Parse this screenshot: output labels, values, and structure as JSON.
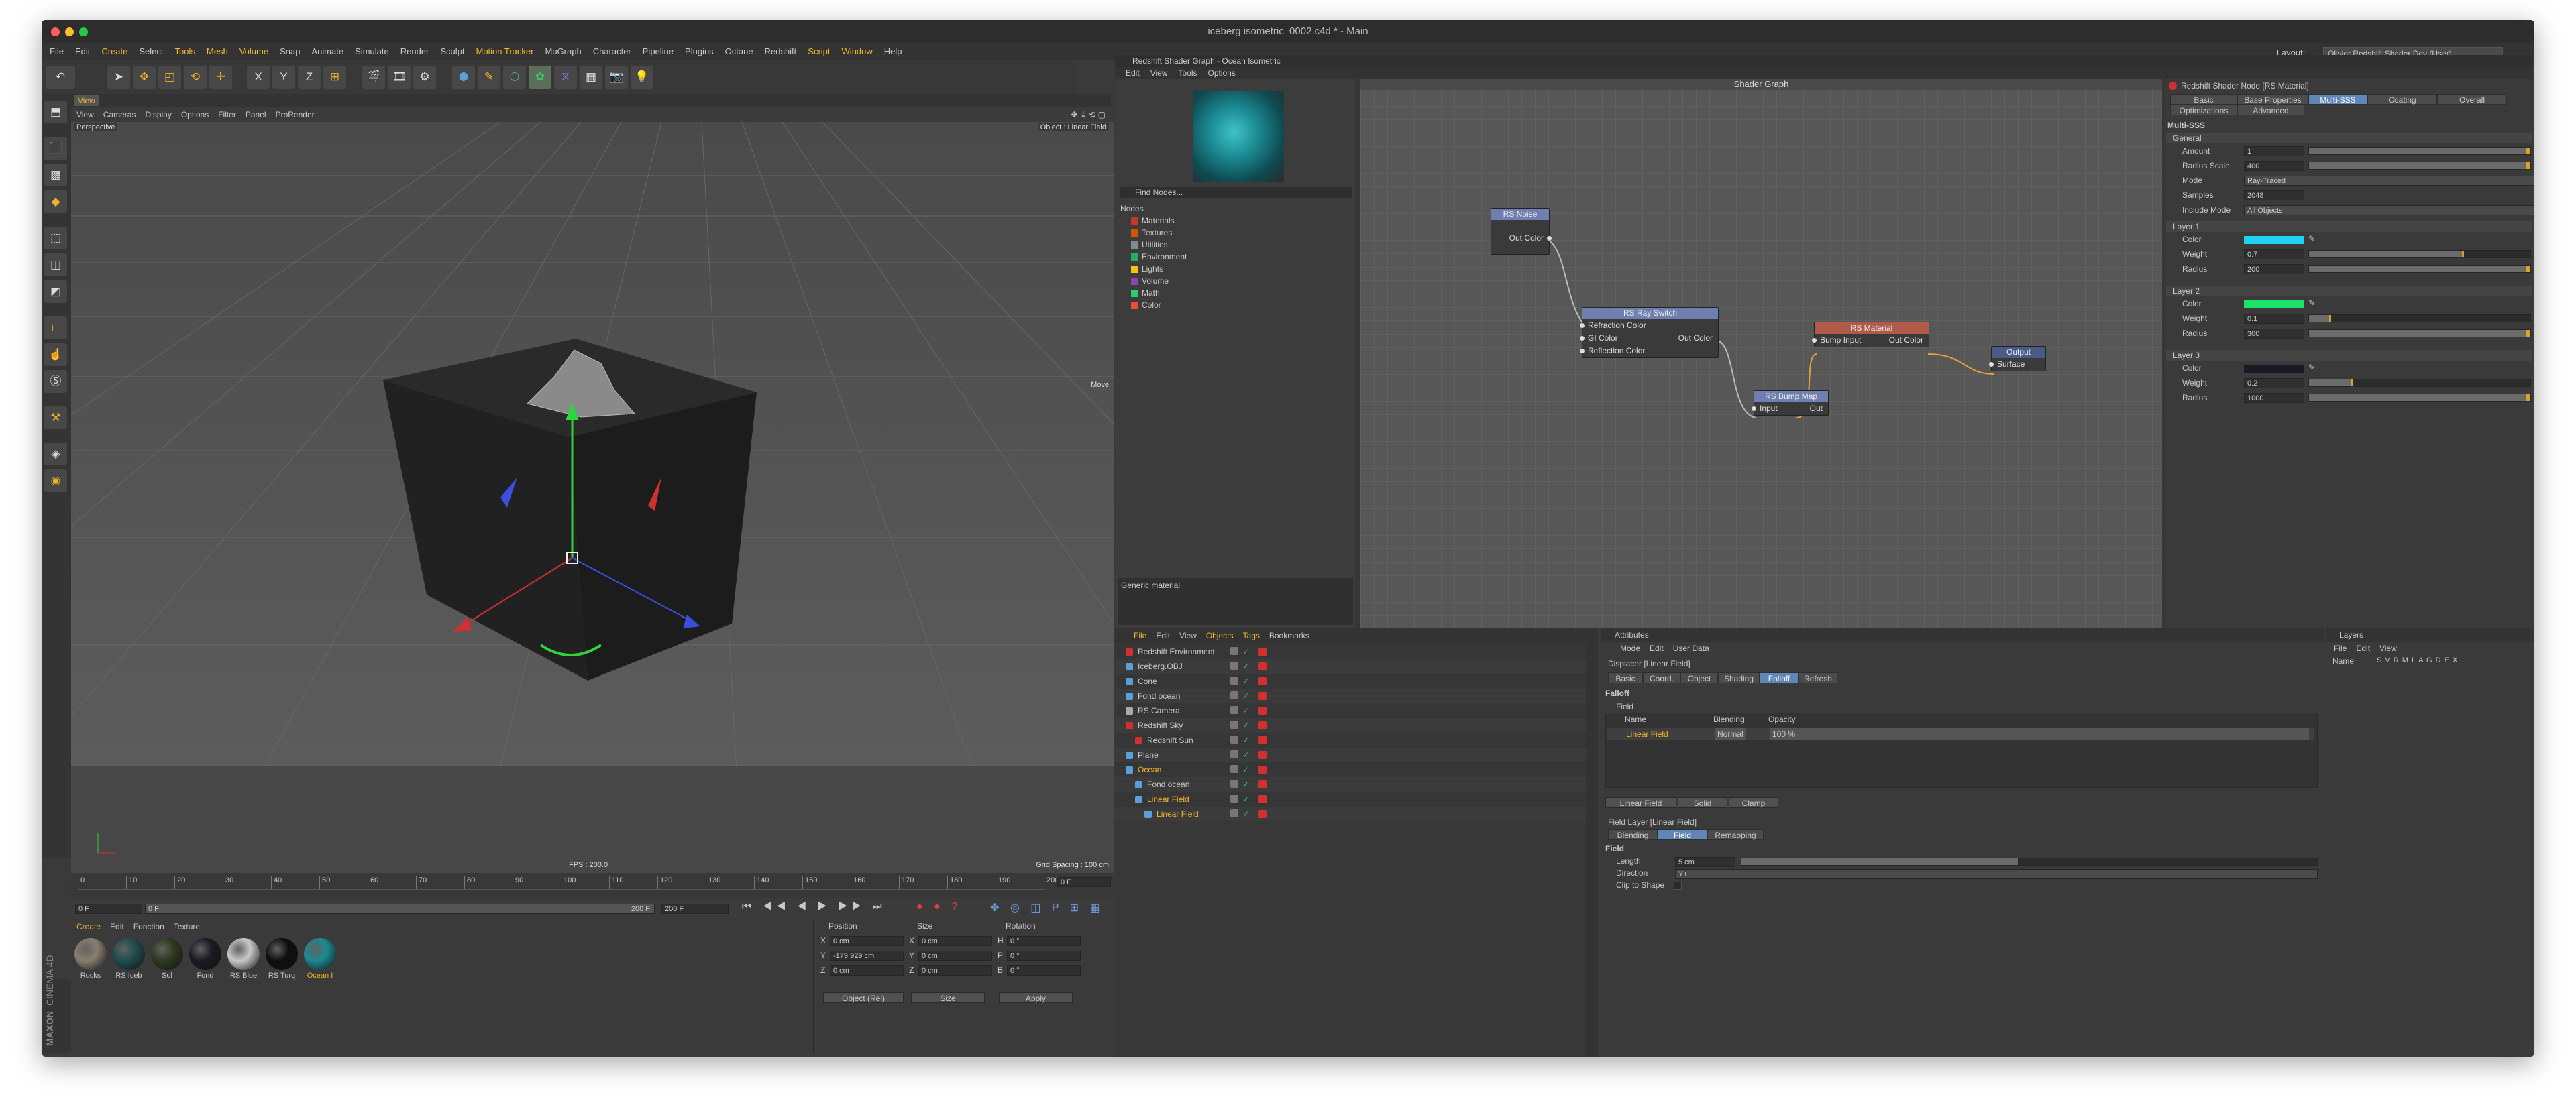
{
  "window": {
    "title": "iceberg isometric_0002.c4d * - Main"
  },
  "menu": [
    "File",
    "Edit",
    "Create",
    "Select",
    "Tools",
    "Mesh",
    "Volume",
    "Snap",
    "Animate",
    "Simulate",
    "Render",
    "Sculpt",
    "Motion Tracker",
    "MoGraph",
    "Character",
    "Pipeline",
    "Plugins",
    "Octane",
    "Redshift",
    "Script",
    "Window",
    "Help"
  ],
  "menu_highlight": [
    "Create",
    "Tools",
    "Mesh",
    "Volume",
    "Motion Tracker",
    "Script",
    "Window"
  ],
  "layout": {
    "label": "Layout:",
    "value": "Olivier Redshift Shader Dev (User)"
  },
  "toolbar": {
    "x": "X",
    "y": "Y",
    "z": "Z"
  },
  "viewport": {
    "tab": "View",
    "menu": [
      "View",
      "Cameras",
      "Display",
      "Options",
      "Filter",
      "Panel",
      "ProRender"
    ],
    "perspective": "Perspective",
    "object_label": "Object : Linear Field",
    "move": "Move",
    "fps": "FPS : 200.0",
    "grid_spacing": "Grid Spacing : 100 cm"
  },
  "timeline": {
    "ticks": [
      "0",
      "10",
      "20",
      "30",
      "40",
      "50",
      "60",
      "70",
      "80",
      "90",
      "100",
      "110",
      "120",
      "130",
      "140",
      "150",
      "160",
      "170",
      "180",
      "190",
      "200"
    ],
    "current": "0 F",
    "start": "0 F",
    "end_a": "200 F",
    "end_b": "200 F",
    "right_field": "0 F"
  },
  "materials": {
    "menu": [
      "Create",
      "Edit",
      "Function",
      "Texture"
    ],
    "items": [
      {
        "label": "Rocks",
        "color": "#8a7e70"
      },
      {
        "label": "RS Iceb",
        "color": "#1f4c4f"
      },
      {
        "label": "Sol",
        "color": "#2e3a1f"
      },
      {
        "label": "Fond",
        "color": "#1a1a24"
      },
      {
        "label": "RS Blue",
        "color": "#c9c9c9"
      },
      {
        "label": "RS Turq",
        "color": "#0e0e0e"
      },
      {
        "label": "Ocean I",
        "color": "#1b8a92"
      }
    ]
  },
  "coords": {
    "headers": [
      "Position",
      "Size",
      "Rotation"
    ],
    "rows": [
      {
        "a": "X",
        "av": "0 cm",
        "b": "X",
        "bv": "0 cm",
        "c": "H",
        "cv": "0 °"
      },
      {
        "a": "Y",
        "av": "-179.929 cm",
        "b": "Y",
        "bv": "0 cm",
        "c": "P",
        "cv": "0 °"
      },
      {
        "a": "Z",
        "av": "0 cm",
        "b": "Z",
        "bv": "0 cm",
        "c": "B",
        "cv": "0 °"
      }
    ],
    "mode": "Object (Rel)",
    "size_mode": "Size",
    "apply": "Apply"
  },
  "brand": {
    "maxon": "MAXON",
    "product": "CINEMA 4D"
  },
  "shader_graph": {
    "header": "Redshift Shader Graph - Ocean Isometric",
    "menu": [
      "Edit",
      "View",
      "Tools",
      "Options"
    ],
    "find": "Find Nodes...",
    "nodes_label": "Nodes",
    "categories": [
      {
        "label": "Materials",
        "color": "#c0392b"
      },
      {
        "label": "Textures",
        "color": "#d35400"
      },
      {
        "label": "Utilities",
        "color": "#7f8c8d"
      },
      {
        "label": "Environment",
        "color": "#27ae60"
      },
      {
        "label": "Lights",
        "color": "#f1c40f"
      },
      {
        "label": "Volume",
        "color": "#8e44ad"
      },
      {
        "label": "Math",
        "color": "#2ecc71"
      },
      {
        "label": "Color",
        "color": "#e74c3c"
      }
    ],
    "canvas_title": "Shader Graph",
    "generic": "Generic material",
    "node_noise": {
      "title": "RS Noise",
      "out": "Out Color"
    },
    "node_switch": {
      "title": "RS Ray Switch",
      "in1": "Refraction Color",
      "in2": "GI Color",
      "out": "Out Color",
      "in3": "Reflection Color"
    },
    "node_bump": {
      "title": "RS Bump Map",
      "in": "Input",
      "out": "Out"
    },
    "node_material": {
      "title": "RS Material",
      "in": "Bump Input",
      "out": "Out Color"
    },
    "node_output": {
      "title": "Output",
      "in": "Surface"
    }
  },
  "props": {
    "header": "Redshift Shader Node [RS Material]",
    "tabs_row1": [
      "Basic",
      "Base Properties",
      "Multi-SSS",
      "Coating",
      "Overall"
    ],
    "tabs_row2": [
      "Optimizations",
      "Advanced"
    ],
    "section": "Multi-SSS",
    "general_label": "General",
    "general": [
      {
        "label": "Amount",
        "value": "1",
        "fill": 1.0
      },
      {
        "label": "Radius Scale",
        "value": "400",
        "fill": 1.0
      },
      {
        "label": "Mode",
        "value": "Ray-Traced"
      },
      {
        "label": "Samples",
        "value": "2048"
      },
      {
        "label": "Include Mode",
        "value": "All Objects"
      }
    ],
    "layers": [
      {
        "name": "Layer 1",
        "color": "#1ed1ee",
        "weight": "0.7",
        "wfill": 0.7,
        "radius": "200"
      },
      {
        "label_color": "Color",
        "name": "Layer 2",
        "color": "#19e36b",
        "weight": "0.1",
        "wfill": 0.1,
        "radius": "300"
      },
      {
        "name": "Layer 3",
        "color": "#1a1a25",
        "weight": "0.2",
        "wfill": 0.2,
        "radius": "1000"
      }
    ],
    "color_label": "Color",
    "weight_label": "Weight",
    "radius_label": "Radius"
  },
  "objects": {
    "menu": [
      "File",
      "Edit",
      "View",
      "Objects",
      "Tags",
      "Bookmarks"
    ],
    "rows": [
      {
        "label": "Redshift Environment",
        "indent": 0,
        "icon": "#d03030"
      },
      {
        "label": "Iceberg.OBJ",
        "indent": 0,
        "icon": "#5aa0d8"
      },
      {
        "label": "Cone",
        "indent": 0,
        "icon": "#5aa0d8"
      },
      {
        "label": "Fond ocean",
        "indent": 0,
        "icon": "#5aa0d8"
      },
      {
        "label": "RS Camera",
        "indent": 0,
        "icon": "#aaaaaa"
      },
      {
        "label": "Redshift Sky",
        "indent": 0,
        "icon": "#d03030"
      },
      {
        "label": "Redshift Sun",
        "indent": 1,
        "icon": "#d03030"
      },
      {
        "label": "Plane",
        "indent": 0,
        "icon": "#5aa0d8"
      },
      {
        "label": "Ocean",
        "indent": 0,
        "icon": "#5aa0d8",
        "active": true
      },
      {
        "label": "Fond ocean",
        "indent": 1,
        "icon": "#5aa0d8"
      },
      {
        "label": "Linear Field",
        "indent": 1,
        "icon": "#5aa0d8",
        "active": true
      },
      {
        "label": "Linear Field",
        "indent": 2,
        "icon": "#5aa0d8",
        "active": true
      }
    ]
  },
  "attributes": {
    "title": "Attributes",
    "menu": [
      "Mode",
      "Edit",
      "User Data"
    ],
    "object": "Displacer [Linear Field]",
    "tabs": [
      "Basic",
      "Coord.",
      "Object",
      "Shading",
      "Falloff",
      "Refresh"
    ],
    "falloff_label": "Falloff",
    "field_label": "Field",
    "columns": [
      "Name",
      "Blending",
      "Opacity"
    ],
    "field_row": {
      "name": "Linear Field",
      "blend": "Normal",
      "opacity": "100 %"
    },
    "field_buttons": [
      "Linear Field",
      "Solid",
      "Clamp"
    ],
    "layer_title": "Field Layer [Linear Field]",
    "layer_tabs": [
      "Blending",
      "Field",
      "Remapping"
    ],
    "field_section": "Field",
    "length_label": "Length",
    "length_value": "5 cm",
    "length_fill": 0.48,
    "direction_label": "Direction",
    "direction_value": "Y+",
    "clip_label": "Clip to Shape"
  },
  "layers": {
    "title": "Layers",
    "menu": [
      "File",
      "Edit",
      "View"
    ],
    "name_col": "Name",
    "flags": "S V R M L A G D E X"
  }
}
